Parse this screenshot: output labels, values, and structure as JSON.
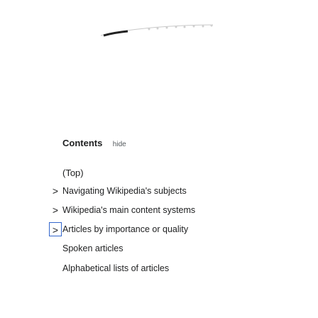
{
  "toc": {
    "title": "Contents",
    "hide_label": "hide",
    "top_label": "(Top)",
    "items": [
      {
        "label": "Navigating Wikipedia's subjects",
        "expandable": true,
        "toggle": ">"
      },
      {
        "label": "Wikipedia's main content systems",
        "expandable": true,
        "toggle": ">"
      },
      {
        "label": "Articles by importance or quality",
        "expandable": true,
        "toggle": ">"
      },
      {
        "label": "Spoken articles",
        "expandable": false
      },
      {
        "label": "Alphabetical lists of articles",
        "expandable": false
      }
    ]
  }
}
